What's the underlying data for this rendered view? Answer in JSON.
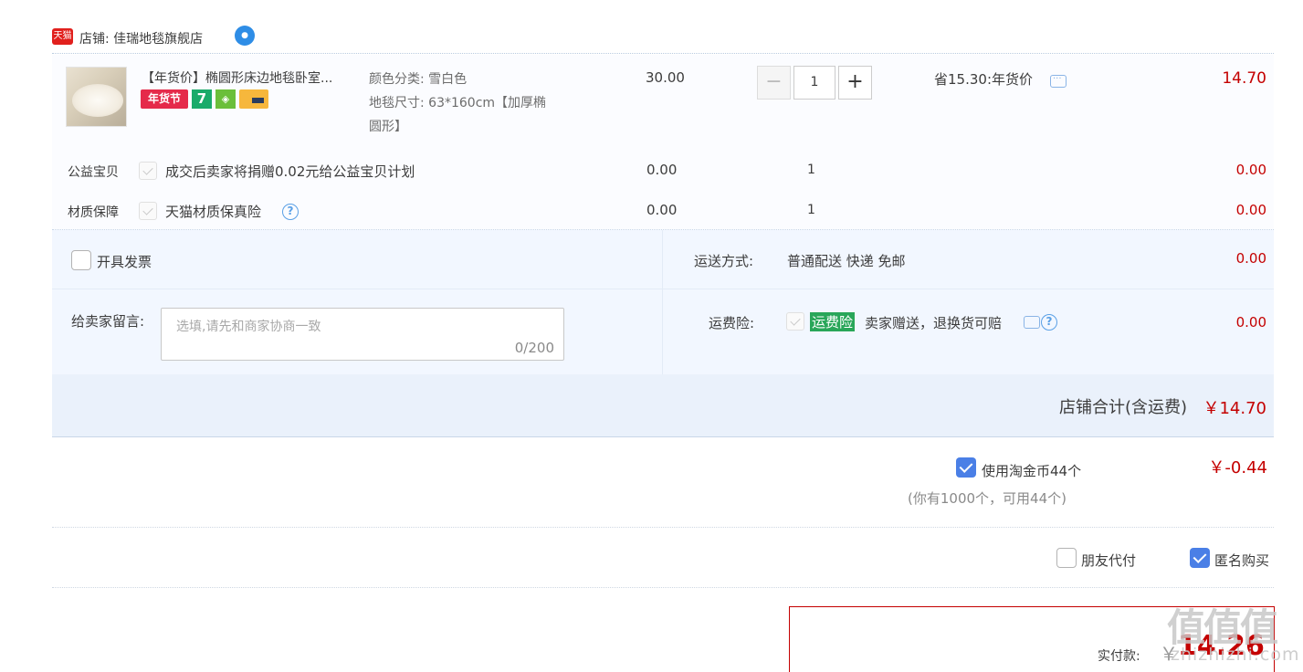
{
  "shop": {
    "platform_logo": "天猫",
    "label": "店铺: 佳瑞地毯旗舰店",
    "ww_icon": "wangwang-chat-icon"
  },
  "item": {
    "title": "【年货价】椭圆形床边地毯卧室...",
    "badges": [
      "年货节",
      "7"
    ],
    "sku_color": "颜色分类: 雪白色",
    "sku_size_1": "地毯尺寸: 63*160cm【加厚椭",
    "sku_size_2": "圆形】",
    "unit_price": "30.00",
    "quantity": "1",
    "minus": "−",
    "plus": "+",
    "promo": "省15.30:年货价",
    "subtotal": "14.70"
  },
  "charity": {
    "label": "公益宝贝",
    "text": "成交后卖家将捐赠0.02元给公益宝贝计划",
    "price": "0.00",
    "qty": "1",
    "total": "0.00"
  },
  "material": {
    "label": "材质保障",
    "text": "天猫材质保真险",
    "help": "?",
    "price": "0.00",
    "qty": "1",
    "total": "0.00"
  },
  "invoice": {
    "label": "开具发票"
  },
  "shipping": {
    "label": "运送方式:",
    "value": "普通配送 快递 免邮",
    "price": "0.00"
  },
  "message": {
    "label": "给卖家留言:",
    "placeholder": "选填,请先和商家协商一致",
    "count": "0/200"
  },
  "insurance": {
    "label": "运费险:",
    "tag": "运费险",
    "text": "卖家赠送，退换货可赔",
    "help": "?",
    "price": "0.00"
  },
  "shop_total": {
    "label": "店铺合计(含运费)",
    "value": "￥14.70"
  },
  "taojinbi": {
    "label": "使用淘金币44个",
    "sub": "(你有1000个，可用44个)",
    "value": "￥-0.44"
  },
  "options": {
    "friend_pay": "朋友代付",
    "anonymous": "匿名购买"
  },
  "payment": {
    "label": "实付款:",
    "yen": "￥",
    "value": "14.26"
  },
  "watermark": {
    "main": "值值值",
    "sub": "zhizhizhi.com"
  },
  "colors": {
    "price_red": "#c40000",
    "accent_blue": "#4a7fe6",
    "insurance_green": "#29a659"
  }
}
